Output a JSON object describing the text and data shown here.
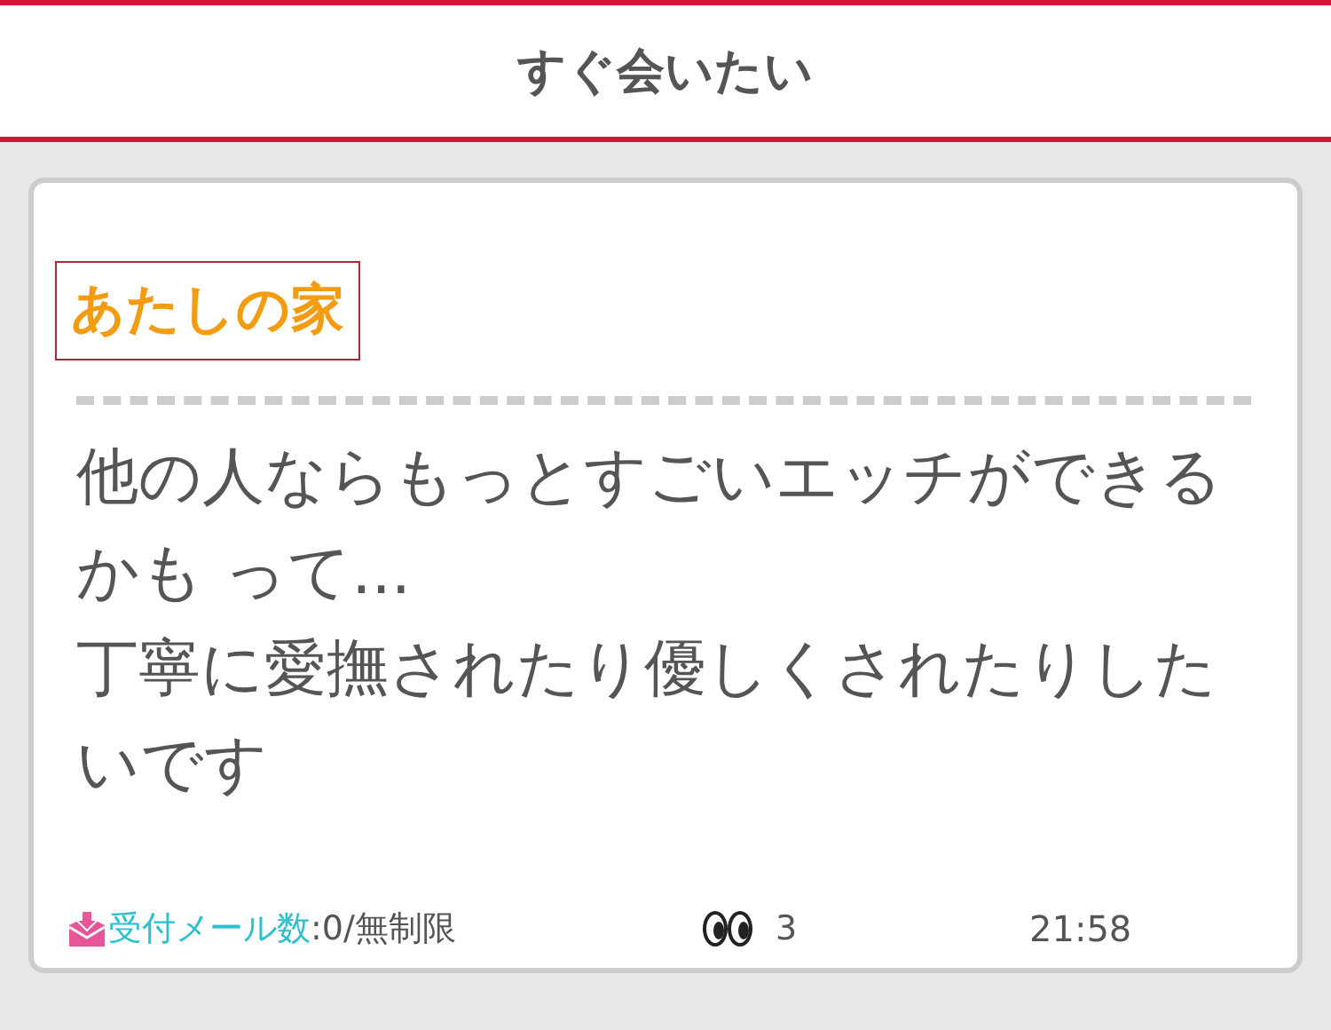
{
  "header": {
    "title": "すぐ会いたい"
  },
  "post": {
    "location": "あたしの家",
    "message": "他の人ならもっとすごいエッチができるかも って...\n丁寧に愛撫されたり優しくされたりしたいです",
    "footer": {
      "mail_label": "受付メール数",
      "mail_value": ":0/無制限",
      "views": "3",
      "time": "21:58"
    }
  }
}
